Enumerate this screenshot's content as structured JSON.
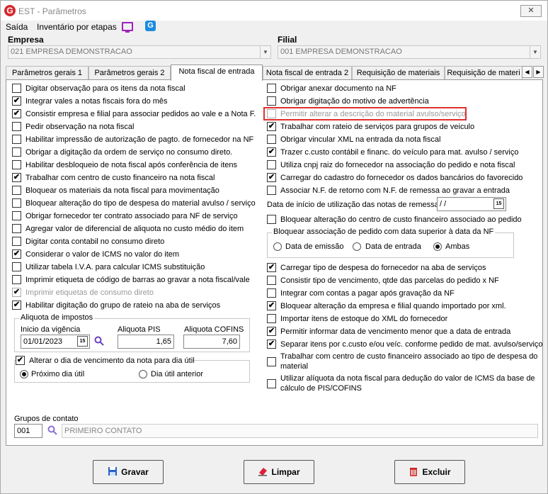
{
  "window": {
    "title": "EST - Parâmetros",
    "close_label": "✕"
  },
  "menu": {
    "items": [
      "Saída",
      "Inventário por etapas"
    ]
  },
  "empresa": {
    "label": "Empresa",
    "value": "021 EMPRESA DEMONSTRACAO"
  },
  "filial": {
    "label": "Filial",
    "value": "001 EMPRESA DEMONSTRACAO"
  },
  "tabs": [
    {
      "label": "Parâmetros gerais 1",
      "active": false
    },
    {
      "label": "Parâmetros gerais 2",
      "active": false
    },
    {
      "label": "Nota fiscal de entrada",
      "active": true
    },
    {
      "label": "Nota fiscal de entrada 2",
      "active": false
    },
    {
      "label": "Requisição de materiais",
      "active": false
    },
    {
      "label": "Requisição de materi",
      "active": false
    }
  ],
  "left_checks": [
    {
      "label": "Digitar observação para os itens da nota fiscal",
      "checked": false
    },
    {
      "label": "Integrar vales a notas fiscais fora do mês",
      "checked": true
    },
    {
      "label": "Consistir empresa e filial para associar pedidos ao vale e a Nota F.",
      "checked": true
    },
    {
      "label": "Pedir observação na nota fiscal",
      "checked": false
    },
    {
      "label": "Habilitar impressão de autorização de pagto. de fornecedor na NF",
      "checked": false
    },
    {
      "label": "Obrigar a digitação da ordem de serviço no consumo direto.",
      "checked": false
    },
    {
      "label": "Habilitar desbloqueio de nota fiscal após conferência de itens",
      "checked": false
    },
    {
      "label": "Trabalhar com centro de custo financeiro na nota fiscal",
      "checked": true
    },
    {
      "label": "Bloquear os materiais da nota fiscal para movimentação",
      "checked": false
    },
    {
      "label": "Bloquear alteração do tipo de despesa do material avulso / serviço",
      "checked": false
    },
    {
      "label": "Obrigar fornecedor ter contrato associado para NF de serviço",
      "checked": false
    },
    {
      "label": "Agregar valor de diferencial de aliquota no custo médio do item",
      "checked": false
    },
    {
      "label": "Digitar conta contabil no consumo direto",
      "checked": false
    },
    {
      "label": "Considerar o valor de ICMS no valor do item",
      "checked": true
    },
    {
      "label": "Utilizar tabela I.V.A. para calcular ICMS substituição",
      "checked": false
    },
    {
      "label": "Imprimir etiqueta de código de barras ao gravar a nota fiscal/vale",
      "checked": false
    },
    {
      "label": "Imprimir etiquetas de consumo direto",
      "checked": true,
      "disabled": true
    },
    {
      "label": "Habilitar digitação do grupo de rateio na aba de serviços",
      "checked": true
    }
  ],
  "aliquota": {
    "title": "Aliquota de impostos",
    "vigencia_label": "Inicio da vigência",
    "vigencia_value": "01/01/2023",
    "pis_label": "Aliquota PIS",
    "pis_value": "1,65",
    "cofins_label": "Aliquota COFINS",
    "cofins_value": "7,60"
  },
  "vencimento": {
    "title": "Alterar o dia de vencimento da nota para dia útil",
    "checked": true,
    "options": [
      {
        "label": "Próximo dia útil",
        "selected": true
      },
      {
        "label": "Dia útil anterior",
        "selected": false
      }
    ]
  },
  "right_checks_top": [
    {
      "label": "Obrigar anexar documento na NF",
      "checked": false
    },
    {
      "label": "Obrigar digitação do motivo de advertência",
      "checked": false
    },
    {
      "label": "Permitir alterar a descrição do material avulso/serviço",
      "checked": false,
      "disabled": true
    },
    {
      "label": "Trabalhar com rateio de serviços para grupos de veiculo",
      "checked": true
    },
    {
      "label": "Obrigar vincular XML na entrada da nota fiscal",
      "checked": false
    },
    {
      "label": "Trazer c.custo contábil e financ. do veículo para mat. avulso / serviço",
      "checked": true
    },
    {
      "label": "Utiliza cnpj raiz do fornecedor na associação do pedido e nota fiscal",
      "checked": false
    },
    {
      "label": "Carregar do cadastro do fornecedor os dados bancários do favorecido",
      "checked": true
    },
    {
      "label": "Associar N.F. de retorno com N.F. de remessa ao gravar a entrada",
      "checked": false
    }
  ],
  "data_inicio": {
    "label": "Data de início de utilização das notas de remessa",
    "value": " /  /"
  },
  "bloquear_cc": {
    "label": "Bloquear alteração do centro de custo financeiro associado ao pedido",
    "checked": false
  },
  "bloquear_pedido": {
    "title": "Bloquear associação de pedido com data superior à data da NF",
    "options": [
      {
        "label": "Data de emissão",
        "selected": false
      },
      {
        "label": "Data de entrada",
        "selected": false
      },
      {
        "label": "Ambas",
        "selected": true
      }
    ]
  },
  "right_checks_bottom": [
    {
      "label": "Carregar tipo de despesa do fornecedor na aba de serviços",
      "checked": true
    },
    {
      "label": "Consistir tipo de vencimento, qtde das parcelas do pedido x NF",
      "checked": false
    },
    {
      "label": "Integrar com contas a pagar após gravação da NF",
      "checked": false
    },
    {
      "label": "Bloquear alteração da empresa e filial quando importado por xml.",
      "checked": true
    },
    {
      "label": "Importar itens de estoque do XML do fornecedor",
      "checked": false
    },
    {
      "label": "Permitir informar data de vencimento menor que a data de entrada",
      "checked": true
    },
    {
      "label": "Separar itens por c.custo e/ou veíc. conforme pedido de mat. avulso/serviço",
      "checked": true
    }
  ],
  "right_checks_multi": [
    {
      "line1": "Trabalhar com centro de custo financeiro associado ao tipo de despesa do",
      "line2": "material",
      "checked": false
    },
    {
      "line1": "Utilizar alíquota da nota fiscal para dedução do valor de ICMS da base de",
      "line2": "cálculo de PIS/COFINS",
      "checked": false
    }
  ],
  "grupos": {
    "label": "Grupos de contato",
    "code": "001",
    "name": "PRIMEIRO CONTATO"
  },
  "buttons": {
    "gravar": "Gravar",
    "limpar": "Limpar",
    "excluir": "Excluir"
  },
  "colors": {
    "accent_red": "#e03030",
    "brand_blue": "#1b8be0",
    "logo_red": "#d7262d"
  }
}
